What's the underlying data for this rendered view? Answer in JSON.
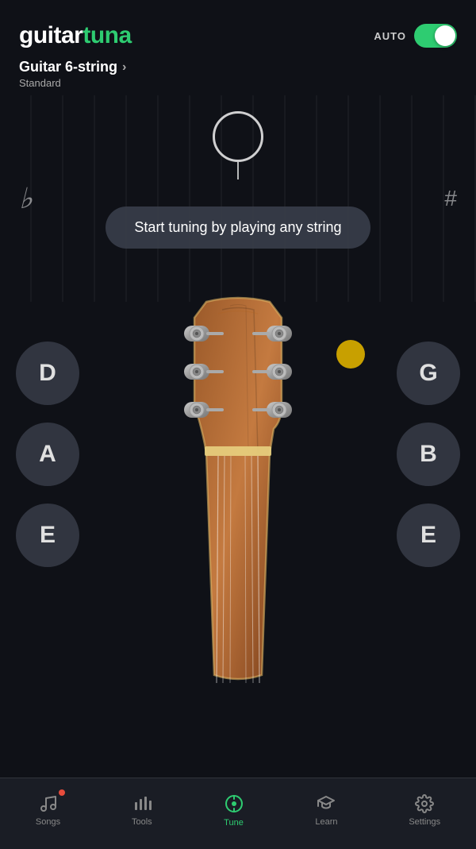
{
  "app": {
    "logo_guitar": "guitar",
    "logo_tuna": "tuna",
    "auto_label": "AUTO"
  },
  "instrument": {
    "name": "Guitar 6-string",
    "tuning": "Standard"
  },
  "tuner": {
    "flat_symbol": "♭",
    "sharp_symbol": "#",
    "prompt": "Start tuning by playing any string"
  },
  "strings": {
    "left": [
      {
        "note": "D",
        "id": "string-d"
      },
      {
        "note": "A",
        "id": "string-a"
      },
      {
        "note": "E",
        "id": "string-e-low"
      }
    ],
    "right": [
      {
        "note": "G",
        "id": "string-g"
      },
      {
        "note": "B",
        "id": "string-b"
      },
      {
        "note": "E",
        "id": "string-e-high"
      }
    ]
  },
  "nav": {
    "items": [
      {
        "label": "Songs",
        "icon": "♩",
        "active": false,
        "has_dot": true,
        "id": "nav-songs"
      },
      {
        "label": "Tools",
        "icon": "📊",
        "active": false,
        "has_dot": false,
        "id": "nav-tools"
      },
      {
        "label": "Tune",
        "icon": "🎸",
        "active": true,
        "has_dot": false,
        "id": "nav-tune"
      },
      {
        "label": "Learn",
        "icon": "🎓",
        "active": false,
        "has_dot": false,
        "id": "nav-learn"
      },
      {
        "label": "Settings",
        "icon": "⚙",
        "active": false,
        "has_dot": false,
        "id": "nav-settings"
      }
    ]
  }
}
